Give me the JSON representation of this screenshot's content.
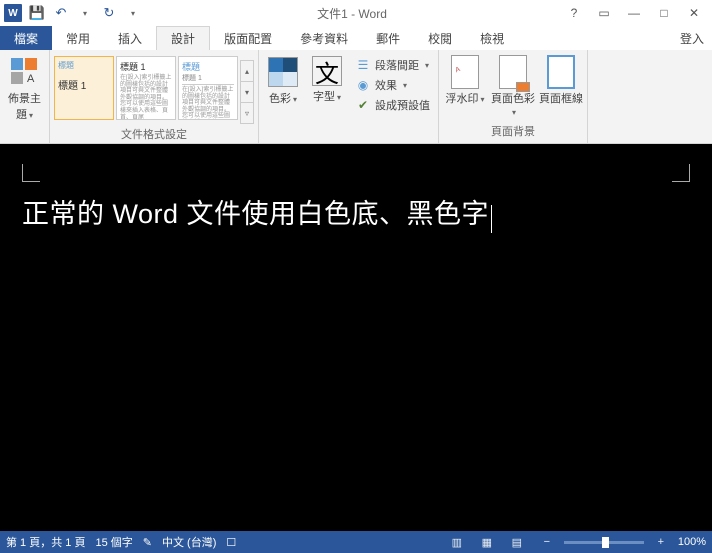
{
  "title": "文件1 - Word",
  "qat": {
    "save": "💾",
    "undo": "↶",
    "redo": "↻"
  },
  "winctrl": {
    "help": "?",
    "ribbon": "▭",
    "min": "—",
    "max": "□",
    "close": "✕"
  },
  "tabs": {
    "file": "檔案",
    "items": [
      "常用",
      "插入",
      "設計",
      "版面配置",
      "參考資料",
      "郵件",
      "校閱",
      "檢視"
    ],
    "login": "登入"
  },
  "ribbon": {
    "themes": {
      "btn": "佈景主題",
      "dd": "▾"
    },
    "gallery": {
      "item1_title": "標題",
      "item1_sub": "標題 1",
      "item2_title": "標題 1",
      "item3_title": "標題",
      "item3_sub": "標題 1",
      "lorem": "在[設入]索引標籤上的圖樣包括的設計項目可與文件整體外觀協調的項目。您可以使用這些圖樣來插入表格、頁首、頁尾"
    },
    "group_format": "文件格式設定",
    "colors": "色彩",
    "fonts": "字型",
    "para_spacing": "段落間距",
    "effects": "效果",
    "set_default": "設成預設值",
    "watermark": "浮水印",
    "page_color": "頁面色彩",
    "page_border": "頁面框線",
    "group_bg": "頁面背景"
  },
  "doc": {
    "text": "正常的 Word 文件使用白色底、黑色字"
  },
  "status": {
    "page": "第 1 頁，共 1 頁",
    "words": "15 個字",
    "proof": "✎",
    "lang": "中文 (台灣)",
    "ime": "☐",
    "zoom_minus": "−",
    "zoom_plus": "+",
    "zoom_pct": "100%"
  }
}
